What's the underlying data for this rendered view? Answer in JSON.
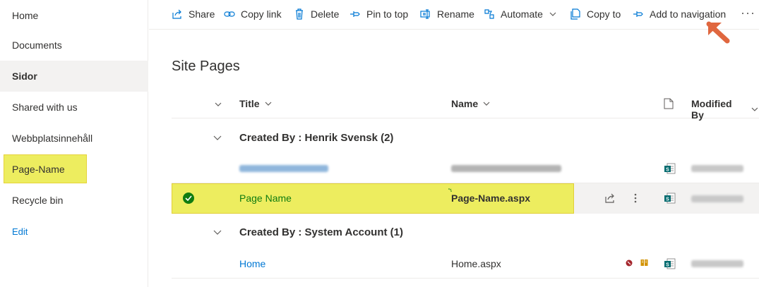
{
  "sidebar": {
    "items": [
      {
        "label": "Home"
      },
      {
        "label": "Documents"
      },
      {
        "label": "Sidor"
      },
      {
        "label": "Shared with us"
      },
      {
        "label": "Webbplatsinnehåll"
      },
      {
        "label": "Page-Name"
      },
      {
        "label": "Recycle bin"
      }
    ],
    "edit_label": "Edit"
  },
  "commandbar": {
    "share": "Share",
    "copy_link": "Copy link",
    "delete": "Delete",
    "pin_to_top": "Pin to top",
    "rename": "Rename",
    "automate": "Automate",
    "copy_to": "Copy to",
    "add_to_navigation": "Add to navigation",
    "more": "···"
  },
  "page": {
    "title": "Site Pages"
  },
  "columns": {
    "title": "Title",
    "name": "Name",
    "modified_by": "Modified By"
  },
  "groups": [
    {
      "label": "Created By : Henrik Svensk (2)",
      "rows": [
        {
          "title": "",
          "name": "",
          "blurred": true
        },
        {
          "title": "Page Name",
          "name": "Page-Name.aspx",
          "selected": true
        }
      ]
    },
    {
      "label": "Created By : System Account (1)",
      "rows": [
        {
          "title": "Home",
          "name": "Home.aspx"
        }
      ]
    }
  ],
  "colors": {
    "accent": "#0078d4",
    "highlight": "#eded5f",
    "arrow": "#e0673f",
    "selected_check": "#107c10",
    "sharepoint_green": "#036c70"
  }
}
